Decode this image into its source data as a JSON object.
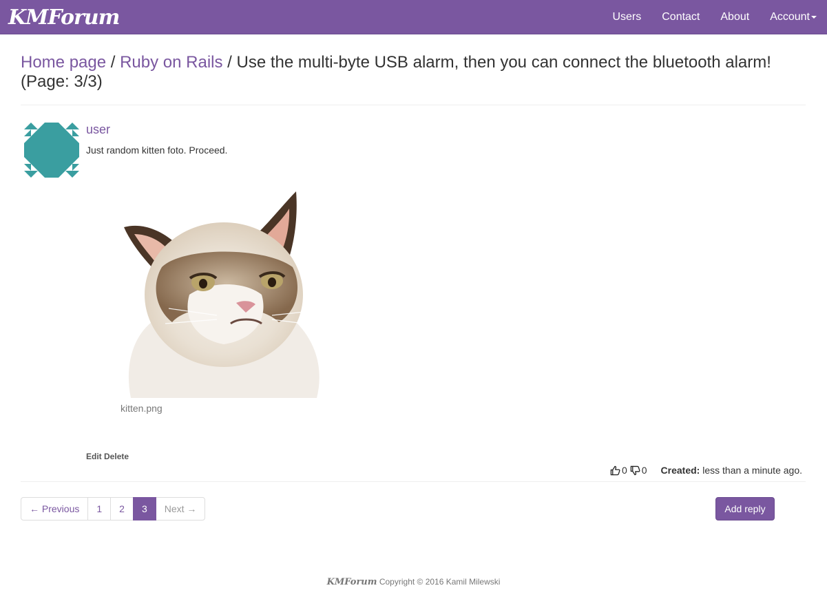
{
  "navbar": {
    "brand": "KMForum",
    "items": [
      {
        "label": "Users"
      },
      {
        "label": "Contact"
      },
      {
        "label": "About"
      },
      {
        "label": "Account"
      }
    ]
  },
  "breadcrumb": {
    "home": "Home page",
    "sep1": " / ",
    "category": "Ruby on Rails",
    "sep2": " / ",
    "topic": "Use the multi-byte USB alarm, then you can connect the bluetooth alarm!",
    "page": "(Page: 3/3)"
  },
  "post": {
    "username": "user",
    "body": "Just random kitten foto. Proceed.",
    "attachment_name": "kitten.png",
    "edit_label": "Edit",
    "delete_label": "Delete",
    "likes": "0",
    "dislikes": "0",
    "created_label": "Created:",
    "created_value": "less than a minute ago.",
    "avatar_color": "#3a9ea0"
  },
  "pagination": {
    "previous": "← Previous",
    "pages": [
      "1",
      "2",
      "3"
    ],
    "current": "3",
    "next": "Next →"
  },
  "add_reply_label": "Add reply",
  "footer": {
    "brand": "KMForum",
    "text": "Copyright © 2016 Kamil Milewski"
  },
  "colors": {
    "accent": "#7a57a0",
    "avatar": "#3a9ea0"
  }
}
